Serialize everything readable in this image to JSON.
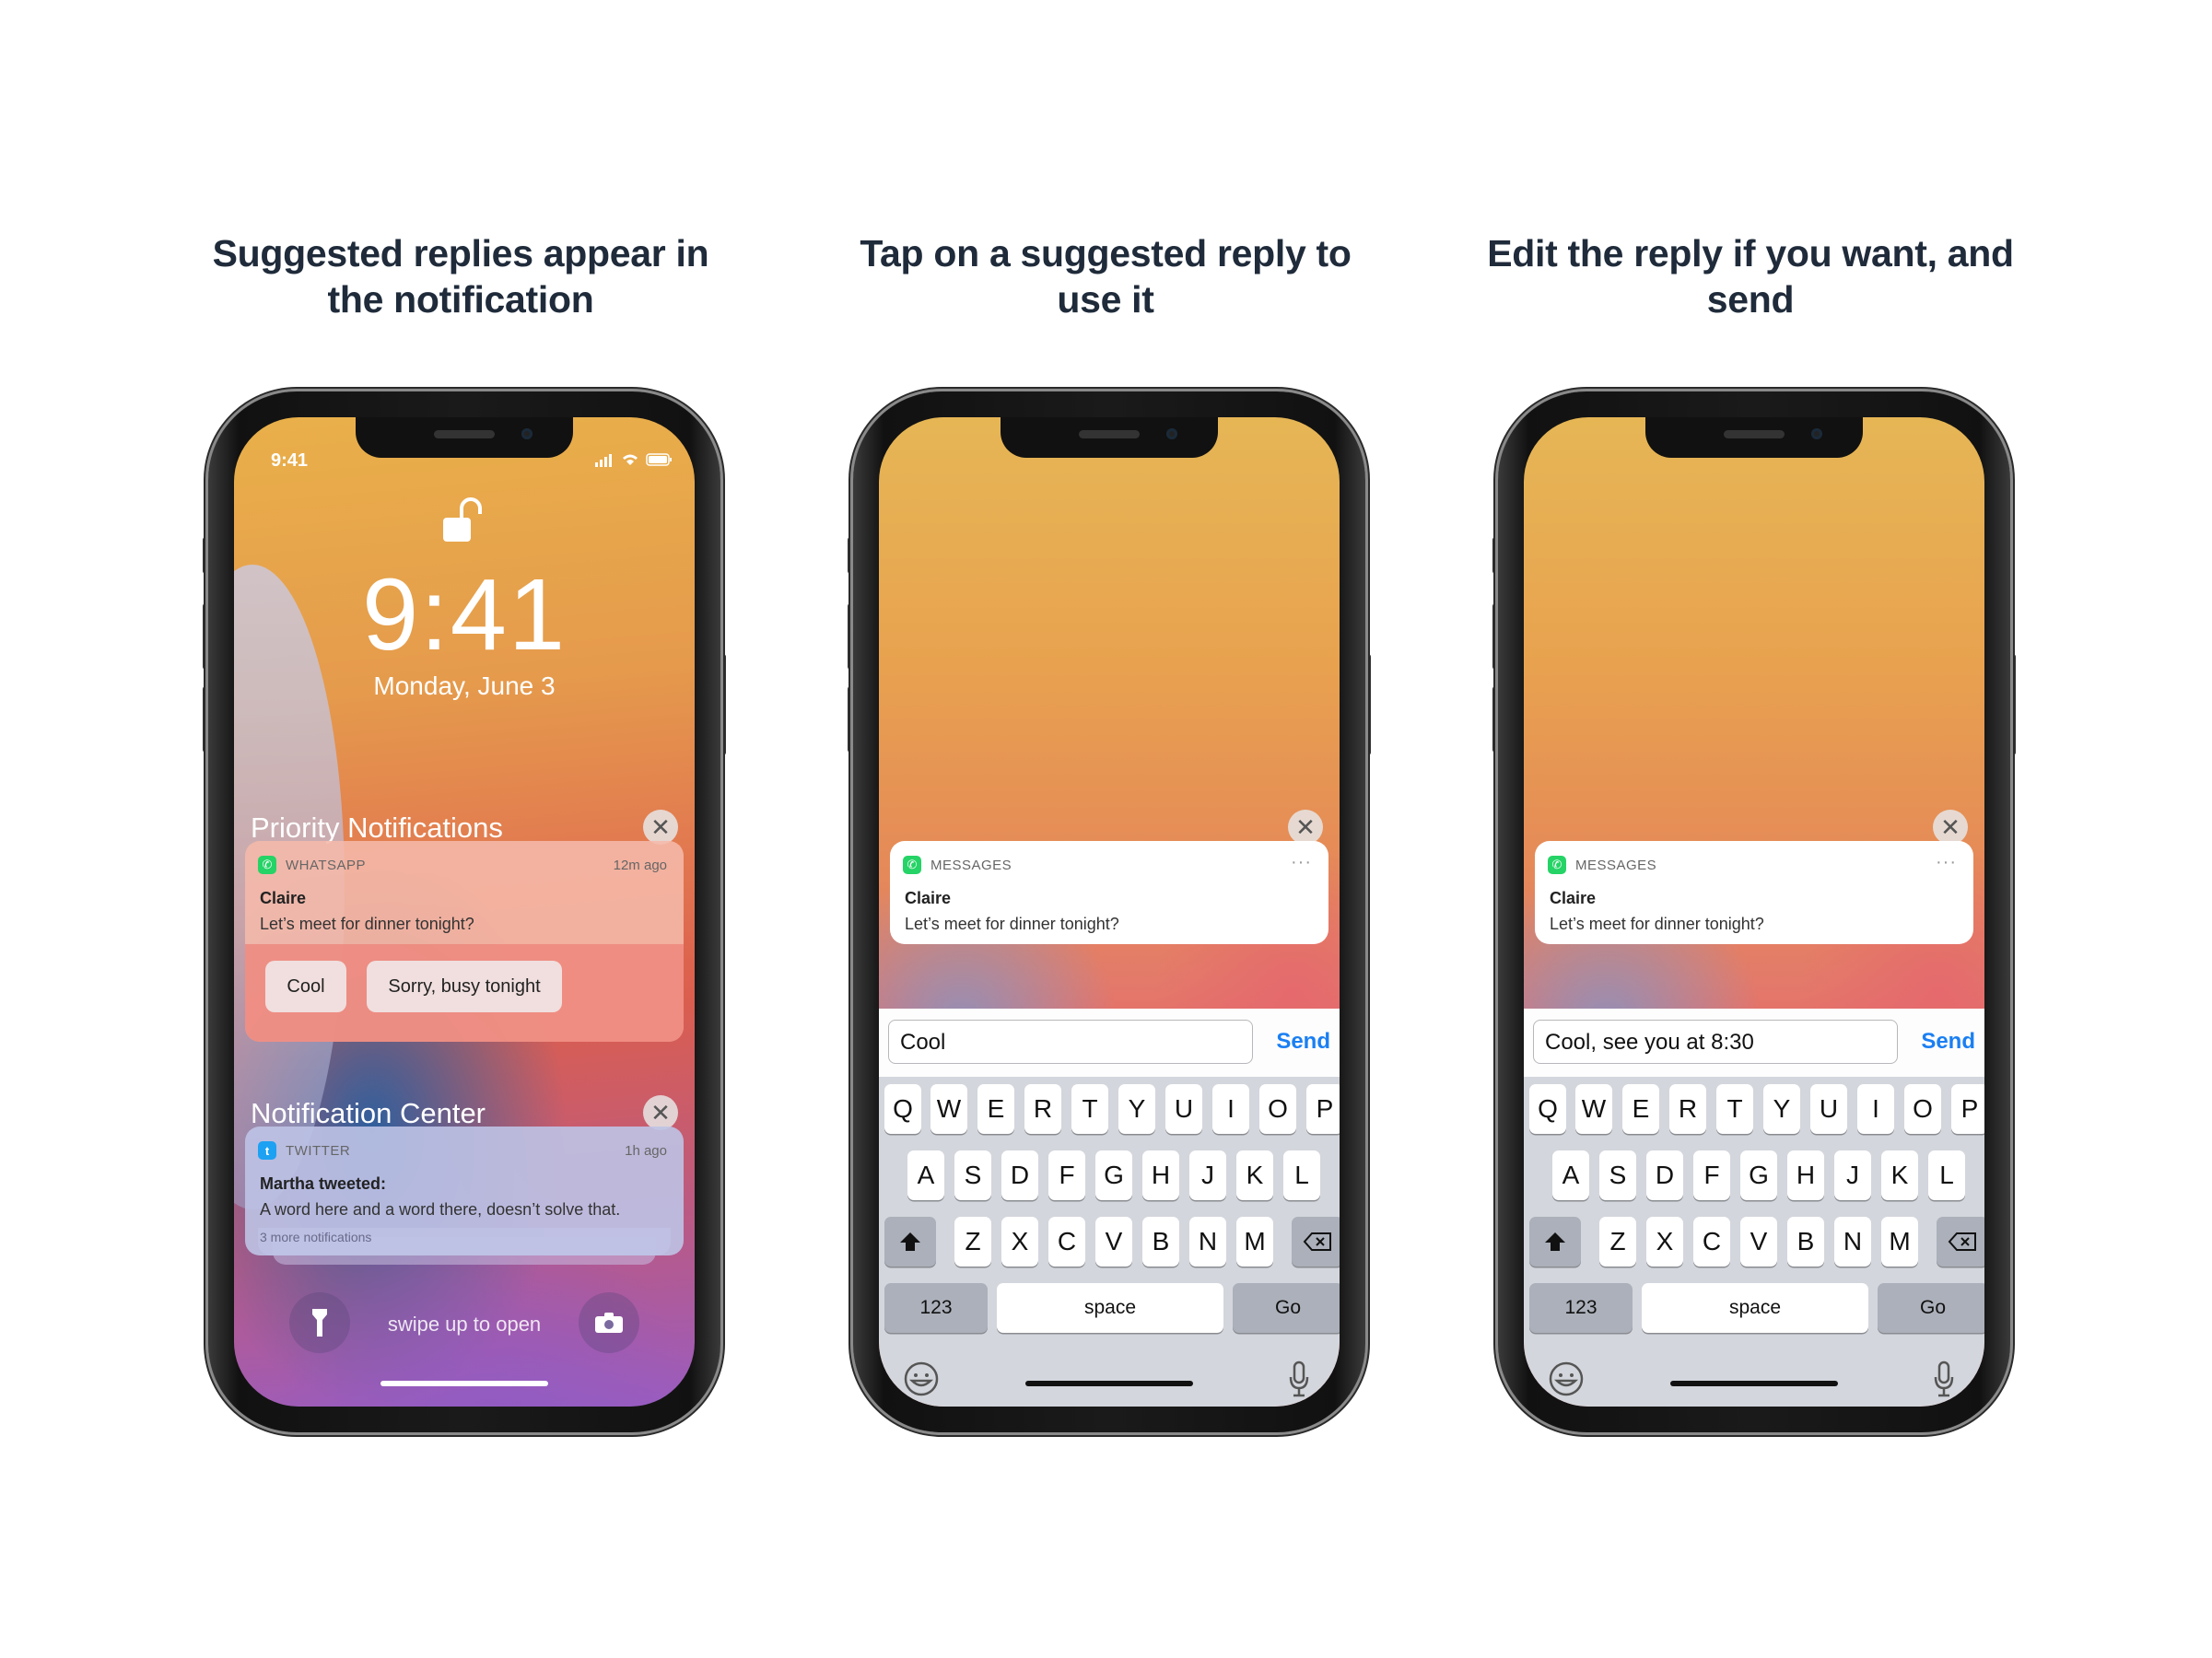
{
  "headings": [
    "Suggested replies appear in the notification",
    "Tap on a suggested reply to use it",
    "Edit the reply if you want, and send"
  ],
  "lockscreen": {
    "status_time": "9:41",
    "time": "9:41",
    "date": "Monday, June 3",
    "priority_title": "Priority Notifications",
    "priority_notification": {
      "app": "WHATSAPP",
      "time": "12m ago",
      "sender": "Claire",
      "message": "Let’s meet for dinner tonight?",
      "replies": [
        "Cool",
        "Sorry, busy tonight"
      ]
    },
    "center_title": "Notification Center",
    "center_notification": {
      "app": "TWITTER",
      "time": "1h ago",
      "sender": "Martha tweeted:",
      "message": "A word here and a word there, doesn’t solve that.",
      "more": "3 more notifications"
    },
    "swipe_text": "swipe up to open",
    "icons": [
      "flashlight-icon",
      "camera-icon",
      "lock-open-icon"
    ]
  },
  "reply_screens": [
    {
      "app": "MESSAGES",
      "sender": "Claire",
      "message": "Let’s meet for dinner tonight?",
      "input_value": "Cool",
      "send_label": "Send"
    },
    {
      "app": "MESSAGES",
      "sender": "Claire",
      "message": "Let’s meet for dinner tonight?",
      "input_value": "Cool, see you at 8:30",
      "send_label": "Send"
    }
  ],
  "keyboard": {
    "row1": [
      "Q",
      "W",
      "E",
      "R",
      "T",
      "Y",
      "U",
      "I",
      "O",
      "P"
    ],
    "row2": [
      "A",
      "S",
      "D",
      "F",
      "G",
      "H",
      "J",
      "K",
      "L"
    ],
    "row3": [
      "Z",
      "X",
      "C",
      "V",
      "B",
      "N",
      "M"
    ],
    "numbers_label": "123",
    "space_label": "space",
    "go_label": "Go"
  },
  "colors": {
    "heading": "#1f2b3a",
    "send_blue": "#1a7ff3",
    "whatsapp_green": "#25d366",
    "twitter_blue": "#1da1f2"
  }
}
